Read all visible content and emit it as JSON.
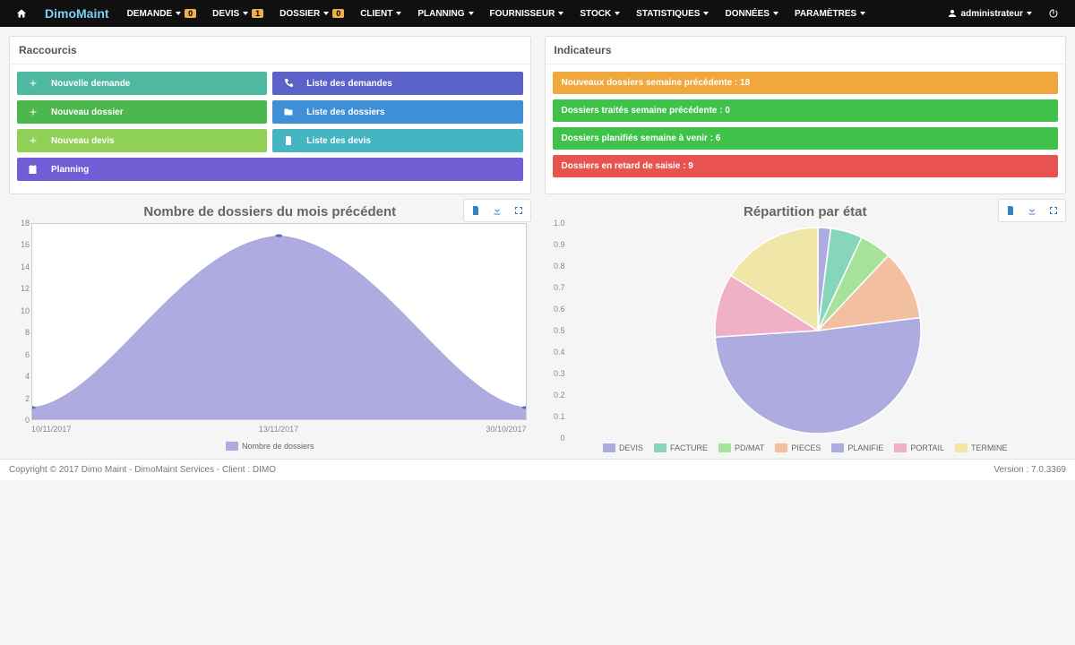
{
  "nav": {
    "items": [
      {
        "label": "DEMANDE",
        "badge": "0"
      },
      {
        "label": "DEVIS",
        "badge": "1"
      },
      {
        "label": "DOSSIER",
        "badge": "0"
      },
      {
        "label": "CLIENT"
      },
      {
        "label": "PLANNING"
      },
      {
        "label": "FOURNISSEUR"
      },
      {
        "label": "STOCK"
      },
      {
        "label": "STATISTIQUES"
      },
      {
        "label": "DONNÉES"
      },
      {
        "label": "PARAMÈTRES"
      }
    ],
    "user": "administrateur",
    "logo": "DimoMaint"
  },
  "raccourcis": {
    "title": "Raccourcis",
    "items": {
      "r0": "Nouvelle demande",
      "r1": "Liste des demandes",
      "r2": "Nouveau dossier",
      "r3": "Liste des dossiers",
      "r4": "Nouveau devis",
      "r5": "Liste des devis",
      "r6": "Planning"
    }
  },
  "indicateurs": {
    "title": "Indicateurs",
    "rows": {
      "i0": "Nouveaux dossiers semaine précédente : 18",
      "i1": "Dossiers traités semaine précédente : 0",
      "i2": "Dossiers planifiés semaine à venir : 6",
      "i3": "Dossiers en retard de saisie : 9"
    }
  },
  "chart_data": [
    {
      "type": "area",
      "title": "Nombre de dossiers du mois précédent",
      "series": [
        {
          "name": "Nombre de dossiers",
          "values": [
            1,
            17,
            1
          ]
        }
      ],
      "x": [
        "10/11/2017",
        "13/11/2017",
        "30/10/2017"
      ],
      "ylim": [
        0,
        18
      ],
      "yticks": [
        0,
        2,
        4,
        6,
        8,
        10,
        12,
        14,
        16,
        18
      ],
      "color": "#adabe0"
    },
    {
      "type": "pie",
      "title": "Répartition par état",
      "series": [
        {
          "name": "DEVIS",
          "value": 0.02,
          "color": "#adabe0"
        },
        {
          "name": "FACTURE",
          "value": 0.05,
          "color": "#86d6bb"
        },
        {
          "name": "PD/MAT",
          "value": 0.05,
          "color": "#a7e29b"
        },
        {
          "name": "PIECES",
          "value": 0.11,
          "color": "#f2c0a1"
        },
        {
          "name": "PLANIFIE",
          "value": 0.51,
          "color": "#adabe0"
        },
        {
          "name": "PORTAIL",
          "value": 0.1,
          "color": "#f0b0c7"
        },
        {
          "name": "TERMINE",
          "value": 0.16,
          "color": "#f0e6a7"
        }
      ],
      "yticks": [
        0,
        0.1,
        0.2,
        0.3,
        0.4,
        0.5,
        0.6,
        0.7,
        0.8,
        0.9,
        1.0
      ]
    }
  ],
  "footer": {
    "copyright": "Copyright © 2017 Dimo Maint - DimoMaint Services - Client : DIMO",
    "version": "Version : 7.0.3369"
  }
}
